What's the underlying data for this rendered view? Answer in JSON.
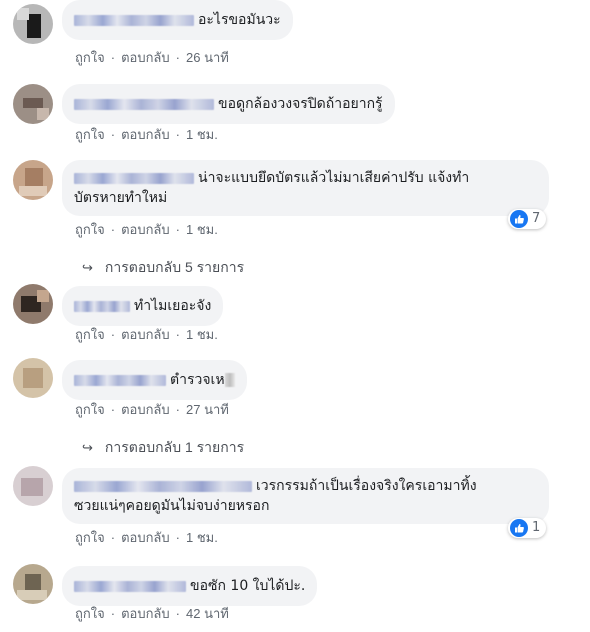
{
  "actions": {
    "like": "ถูกใจ",
    "reply": "ตอบกลับ",
    "separator": "·"
  },
  "colors": {
    "like_blue": "#1877f2",
    "bubble_bg": "#f2f3f5",
    "meta_text": "#606770"
  },
  "comments": [
    {
      "text": "อะไรขอมันวะ",
      "time": "26 นาที"
    },
    {
      "text": "ขอดูกล้องวงจรปิดถ้าอยากรู้",
      "time": "1 ชม."
    },
    {
      "line1": "น่าจะแบบยึดบัตรแล้วไม่มาเสียค่าปรับ แจ้งทำ",
      "line2": "บัตรหายทำใหม่",
      "time": "1 ชม.",
      "likes": "7",
      "replies": "การตอบกลับ 5 รายการ"
    },
    {
      "text": "ทำไมเยอะจัง",
      "time": "1 ชม."
    },
    {
      "text": "ตำรวจเห",
      "time": "27 นาที",
      "replies": "การตอบกลับ 1 รายการ"
    },
    {
      "line1": "เวรกรรมถ้าเป็นเรื่องจริงใครเอามาทิ้ง",
      "line2": "ซวยแน่ๆคอยดูมันไม่จบง่ายหรอก",
      "time": "1 ชม.",
      "likes": "1"
    },
    {
      "text": "ขอซัก 10 ใบได้ปะ.",
      "time": "42 นาที"
    }
  ]
}
